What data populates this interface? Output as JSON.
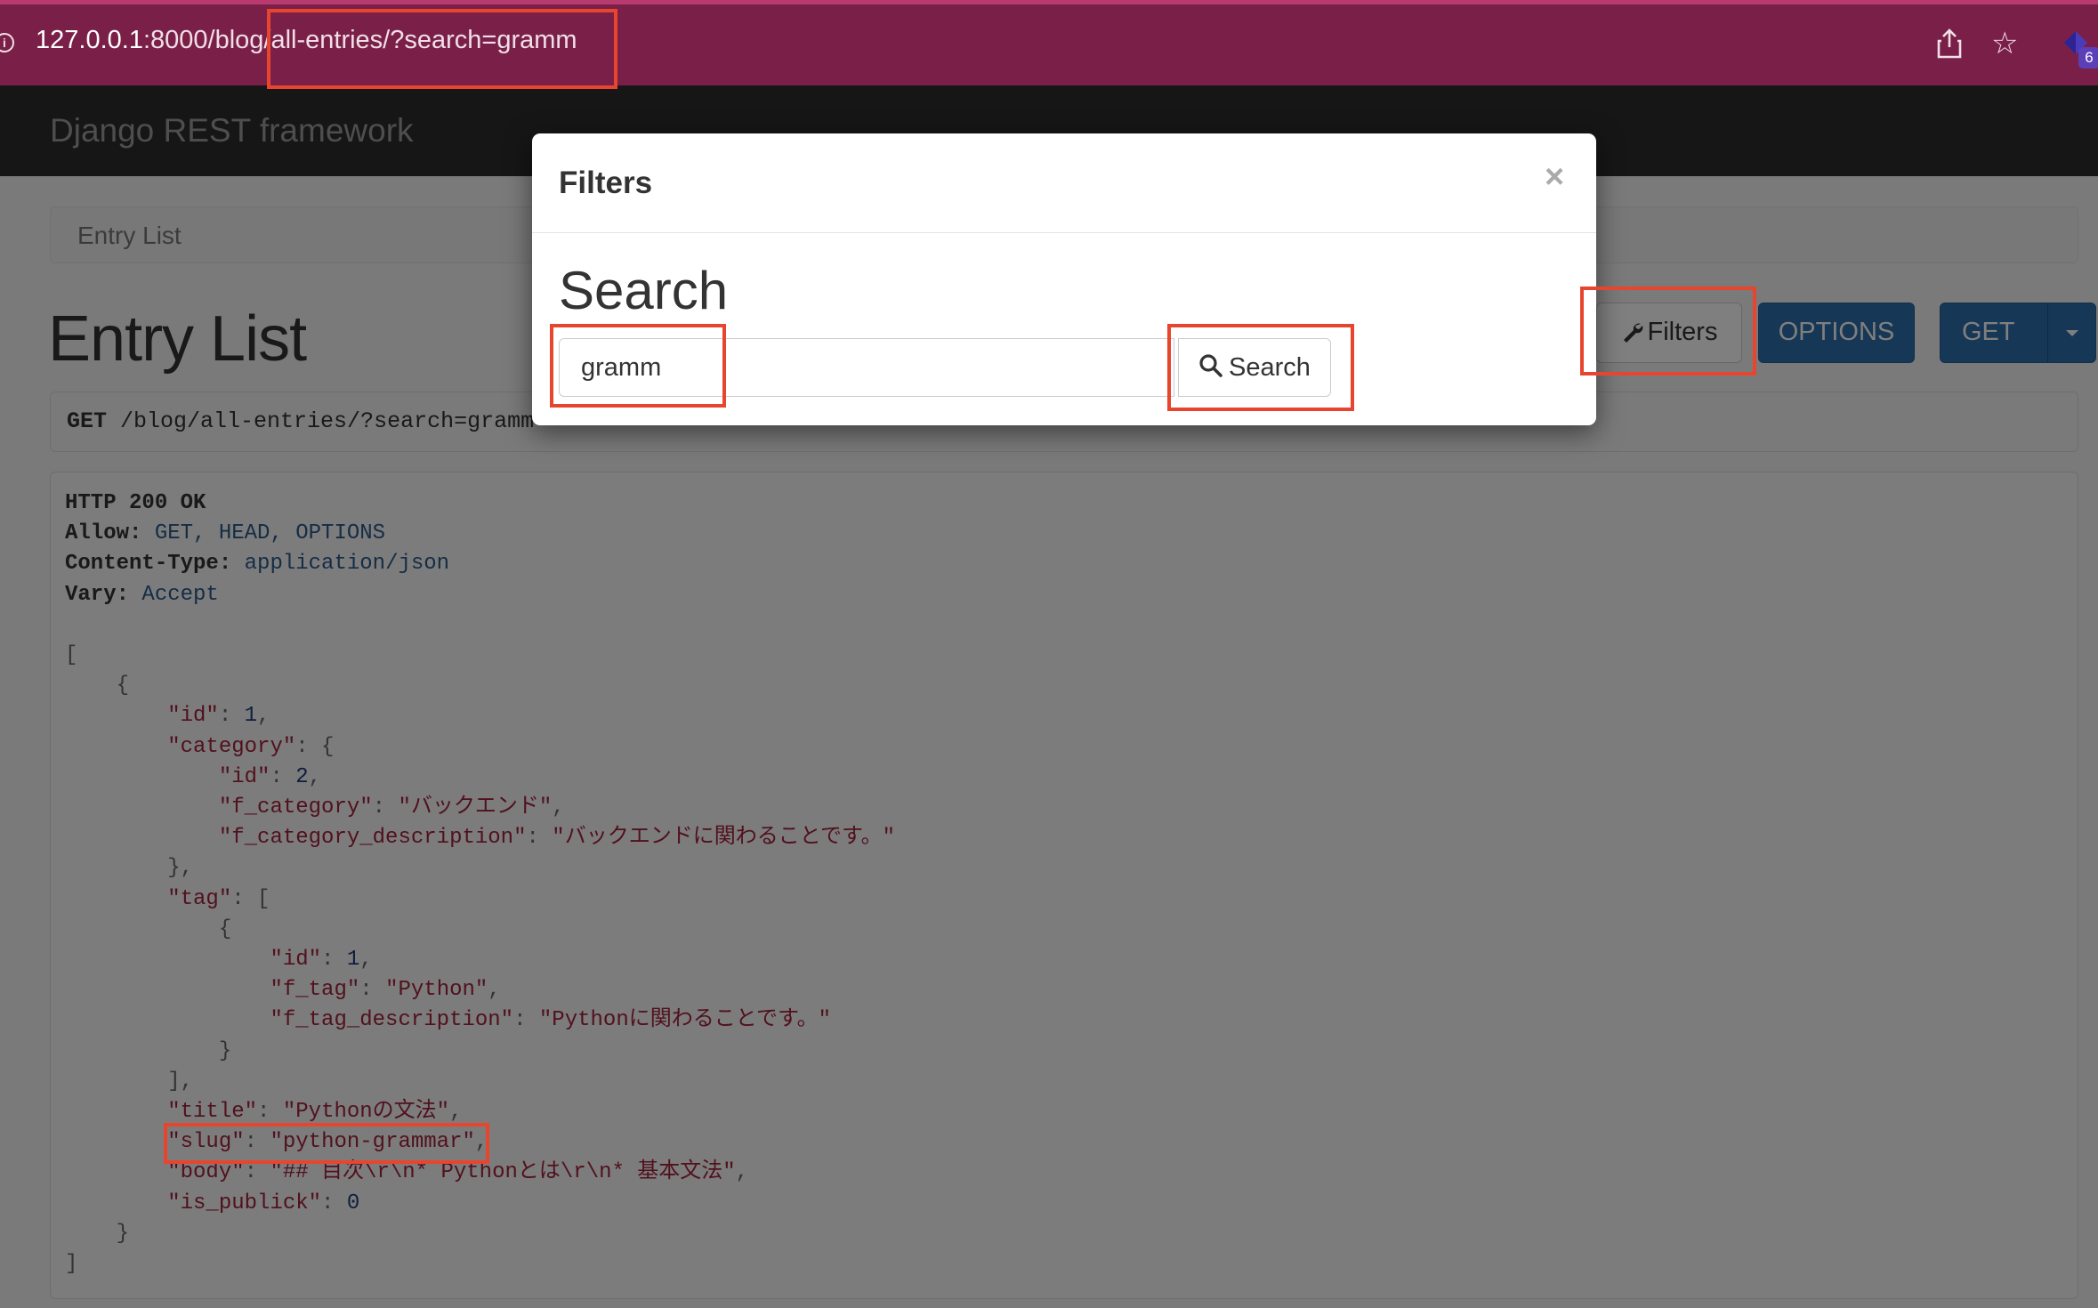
{
  "browser": {
    "url_host": "127.0.0.1",
    "url_rest": ":8000/blog/all-entries/?search=gramm",
    "extension_badge": "6"
  },
  "navbar": {
    "brand": "Django REST framework"
  },
  "breadcrumb": {
    "label": "Entry List"
  },
  "page": {
    "title": "Entry List"
  },
  "toolbar": {
    "filters_label": "Filters",
    "options_label": "OPTIONS",
    "get_label": "GET"
  },
  "request": {
    "method": "GET",
    "path": " /blog/all-entries/?search=gramm"
  },
  "response": {
    "status": "HTTP 200 OK",
    "allow_key": "Allow:",
    "allow_val": " GET, HEAD, OPTIONS",
    "ctype_key": "Content-Type:",
    "ctype_val": " application/json",
    "vary_key": "Vary:",
    "vary_val": " Accept",
    "entry": {
      "id": "1",
      "category": {
        "id": "2",
        "f_category": "\"バックエンド\"",
        "f_category_description": "\"バックエンドに関わることです。\""
      },
      "tag": {
        "id": "1",
        "f_tag": "\"Python\"",
        "f_tag_description": "\"Pythonに関わることです。\""
      },
      "title": "\"Pythonの文法\"",
      "slug": "\"python-grammar\"",
      "body": "\"## 目次\\r\\n* Pythonとは\\r\\n* 基本文法\"",
      "is_publick": "0"
    }
  },
  "modal": {
    "title": "Filters",
    "close": "×",
    "section_heading": "Search",
    "search_value": "gramm",
    "search_button": "Search"
  },
  "colors": {
    "annotation": "#e8452f",
    "primary_button": "#2c6fad",
    "browser_bar": "#7a2048"
  }
}
